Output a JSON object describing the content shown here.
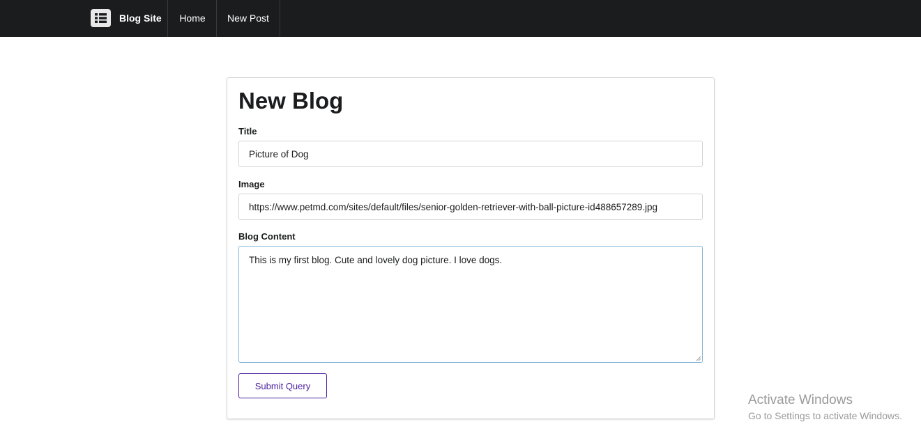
{
  "navbar": {
    "brand_icon": "list-icon",
    "brand_label": "Blog Site",
    "items": [
      {
        "label": "Home"
      },
      {
        "label": "New Post"
      }
    ]
  },
  "form": {
    "heading": "New Blog",
    "title_label": "Title",
    "title_value": "Picture of Dog",
    "image_label": "Image",
    "image_value": "https://www.petmd.com/sites/default/files/senior-golden-retriever-with-ball-picture-id488657289.jpg",
    "content_label": "Blog Content",
    "content_value": "This is my first blog. Cute and lovely dog picture. I love dogs.",
    "submit_label": "Submit Query"
  },
  "watermark": {
    "line1": "Activate Windows",
    "line2": "Go to Settings to activate Windows."
  },
  "colors": {
    "navbar_bg": "#1b1c1d",
    "accent": "#4b1f9e",
    "focus_border": "#85b7d9"
  }
}
